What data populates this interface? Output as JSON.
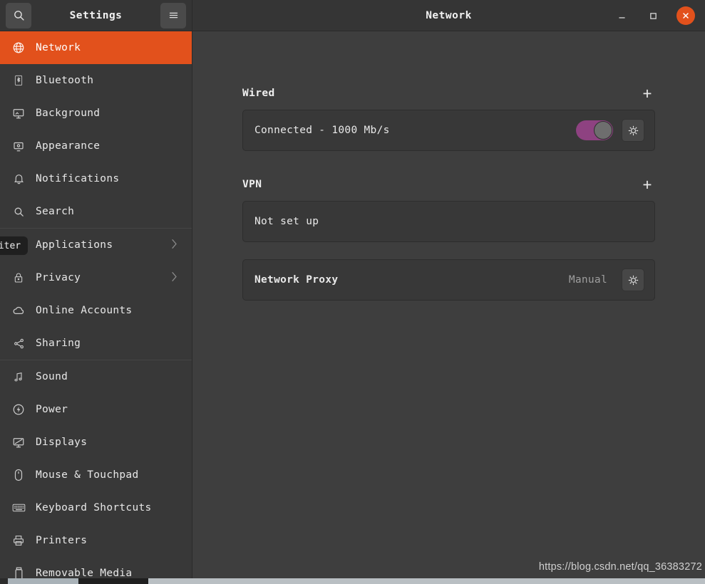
{
  "window": {
    "sidebar_title": "Settings",
    "content_title": "Network",
    "search_icon": "search-icon",
    "menu_icon": "hamburger-menu-icon",
    "minimize_label": "–",
    "maximize_label": "□",
    "close_label": "✕",
    "accent_color": "#e2511c",
    "close_button_color": "#e2511c"
  },
  "sidebar": {
    "items": [
      {
        "label": "Network",
        "icon": "globe-icon",
        "active": true,
        "chevron": false
      },
      {
        "label": "Bluetooth",
        "icon": "bluetooth-icon",
        "active": false,
        "chevron": false
      },
      {
        "label": "Background",
        "icon": "monitor-icon",
        "active": false,
        "chevron": false
      },
      {
        "label": "Appearance",
        "icon": "appearance-icon",
        "active": false,
        "chevron": false
      },
      {
        "label": "Notifications",
        "icon": "bell-icon",
        "active": false,
        "chevron": false
      },
      {
        "label": "Search",
        "icon": "search-icon",
        "active": false,
        "chevron": false
      },
      {
        "label": "Applications",
        "icon": "grid-dots-icon",
        "active": false,
        "chevron": true
      },
      {
        "label": "Privacy",
        "icon": "lock-icon",
        "active": false,
        "chevron": true
      },
      {
        "label": "Online Accounts",
        "icon": "cloud-icon",
        "active": false,
        "chevron": false
      },
      {
        "label": "Sharing",
        "icon": "share-icon",
        "active": false,
        "chevron": false
      },
      {
        "label": "Sound",
        "icon": "music-note-icon",
        "active": false,
        "chevron": false
      },
      {
        "label": "Power",
        "icon": "power-icon",
        "active": false,
        "chevron": false
      },
      {
        "label": "Displays",
        "icon": "display-icon",
        "active": false,
        "chevron": false
      },
      {
        "label": "Mouse & Touchpad",
        "icon": "mouse-icon",
        "active": false,
        "chevron": false
      },
      {
        "label": "Keyboard Shortcuts",
        "icon": "keyboard-icon",
        "active": false,
        "chevron": false
      },
      {
        "label": "Printers",
        "icon": "printer-icon",
        "active": false,
        "chevron": false
      },
      {
        "label": "Removable Media",
        "icon": "usb-drive-icon",
        "active": false,
        "chevron": false
      }
    ],
    "separator_after_indices": [
      5,
      9
    ],
    "tooltip_fragment": "riter"
  },
  "content": {
    "sections": [
      {
        "title": "Wired",
        "add_button": "+",
        "rows": [
          {
            "label": "Connected - 1000 Mb/s",
            "bold": false,
            "value": "",
            "toggle": true,
            "toggle_on": true,
            "gear": true
          }
        ]
      },
      {
        "title": "VPN",
        "add_button": "+",
        "rows": [
          {
            "label": "Not set up",
            "bold": false,
            "value": "",
            "toggle": false,
            "toggle_on": false,
            "gear": false
          }
        ]
      }
    ],
    "proxy": {
      "label": "Network Proxy",
      "value": "Manual",
      "gear_icon": "gear-icon"
    }
  },
  "watermark": {
    "text": "https://blog.csdn.net/qq_36383272"
  }
}
